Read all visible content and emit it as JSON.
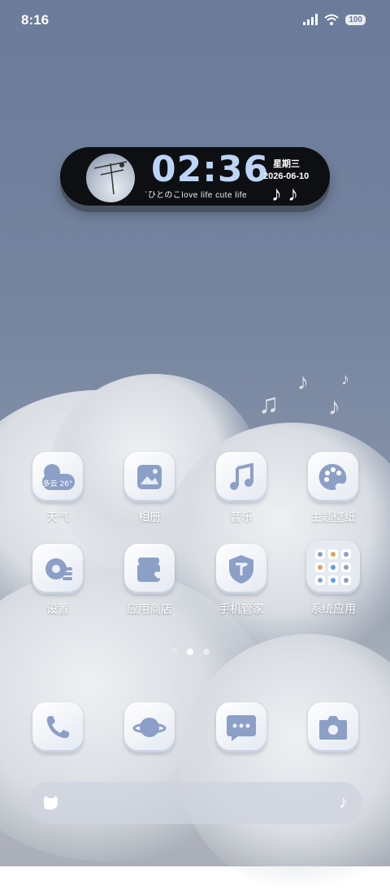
{
  "status_bar": {
    "time": "8:16",
    "battery": "100"
  },
  "widget": {
    "clock": "02:36",
    "weekday": "星期三",
    "date": "2026-06-10",
    "subtitle": "`ひとのこlove life cute life",
    "notes": "♪ ♪"
  },
  "apps": [
    {
      "label": "天气",
      "icon": "weather-icon",
      "badge": "多云 26°"
    },
    {
      "label": "相册",
      "icon": "gallery-icon"
    },
    {
      "label": "音乐",
      "icon": "music-icon"
    },
    {
      "label": "主题壁纸",
      "icon": "palette-icon"
    },
    {
      "label": "设置",
      "icon": "gear-icon"
    },
    {
      "label": "应用商店",
      "icon": "store-icon"
    },
    {
      "label": "手机管家",
      "icon": "shield-icon"
    },
    {
      "label": "系统应用",
      "icon": "folder-icon"
    }
  ],
  "page_indicator": {
    "pages": 3,
    "active": 2
  },
  "dock": [
    {
      "icon": "phone-icon"
    },
    {
      "icon": "browser-icon"
    },
    {
      "icon": "messages-icon"
    },
    {
      "icon": "camera-icon"
    }
  ],
  "colors": {
    "accent": "#8a9ec7",
    "icon_fg": "#8c9fc7",
    "clock": "#bcd4f6"
  }
}
